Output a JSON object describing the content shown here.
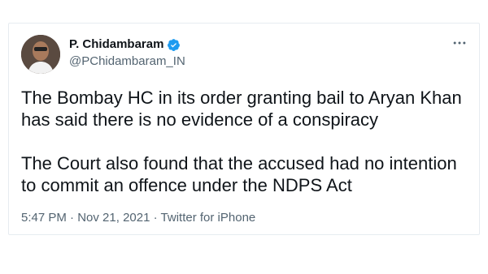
{
  "tweet": {
    "author": {
      "display_name": "P. Chidambaram",
      "handle": "@PChidambaram_IN",
      "verified": true
    },
    "text": "The Bombay HC in its order granting bail to Aryan Khan has said there is no evidence of a conspiracy\n\nThe Court also found that the accused had no intention to commit an offence under the NDPS Act",
    "time": "5:47 PM",
    "separator": "·",
    "date": "Nov 21, 2021",
    "source": "Twitter for iPhone"
  },
  "icons": {
    "verified": "verified-badge-icon",
    "more": "more-options-icon"
  },
  "colors": {
    "text_primary": "#0f1419",
    "text_secondary": "#536471",
    "verified_blue": "#1d9bf0",
    "border": "#e6ecf0"
  }
}
